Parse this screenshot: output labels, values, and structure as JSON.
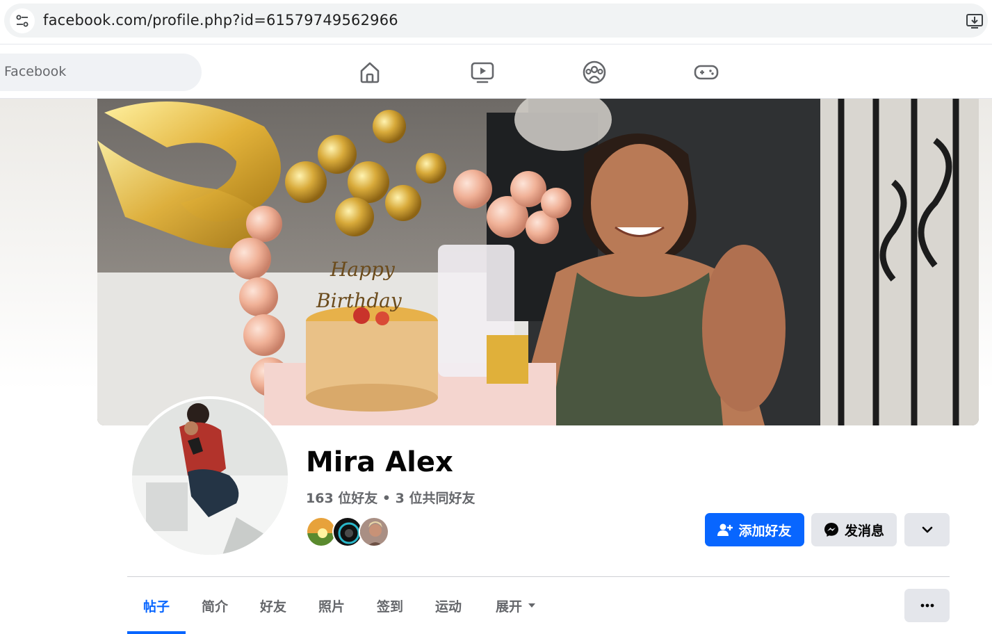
{
  "browser": {
    "url": "facebook.com/profile.php?id=61579749562966"
  },
  "fb_nav": {
    "search_placeholder": "Facebook",
    "icons": [
      "home-icon",
      "video-icon",
      "groups-icon",
      "gaming-icon"
    ]
  },
  "cover": {
    "cake_text_line1": "Happy",
    "cake_text_line2": "Birthday"
  },
  "profile": {
    "name": "Mira Alex",
    "friends_line": "163 位好友 • 3 位共同好友"
  },
  "actions": {
    "add_friend": "添加好友",
    "message": "发消息"
  },
  "tabs": [
    {
      "label": "帖子",
      "active": true
    },
    {
      "label": "简介"
    },
    {
      "label": "好友"
    },
    {
      "label": "照片"
    },
    {
      "label": "签到"
    },
    {
      "label": "运动"
    },
    {
      "label": "展开"
    }
  ],
  "colors": {
    "brand_blue": "#0866ff",
    "secondary_button": "#e4e6eb",
    "muted_text": "#65676b"
  }
}
